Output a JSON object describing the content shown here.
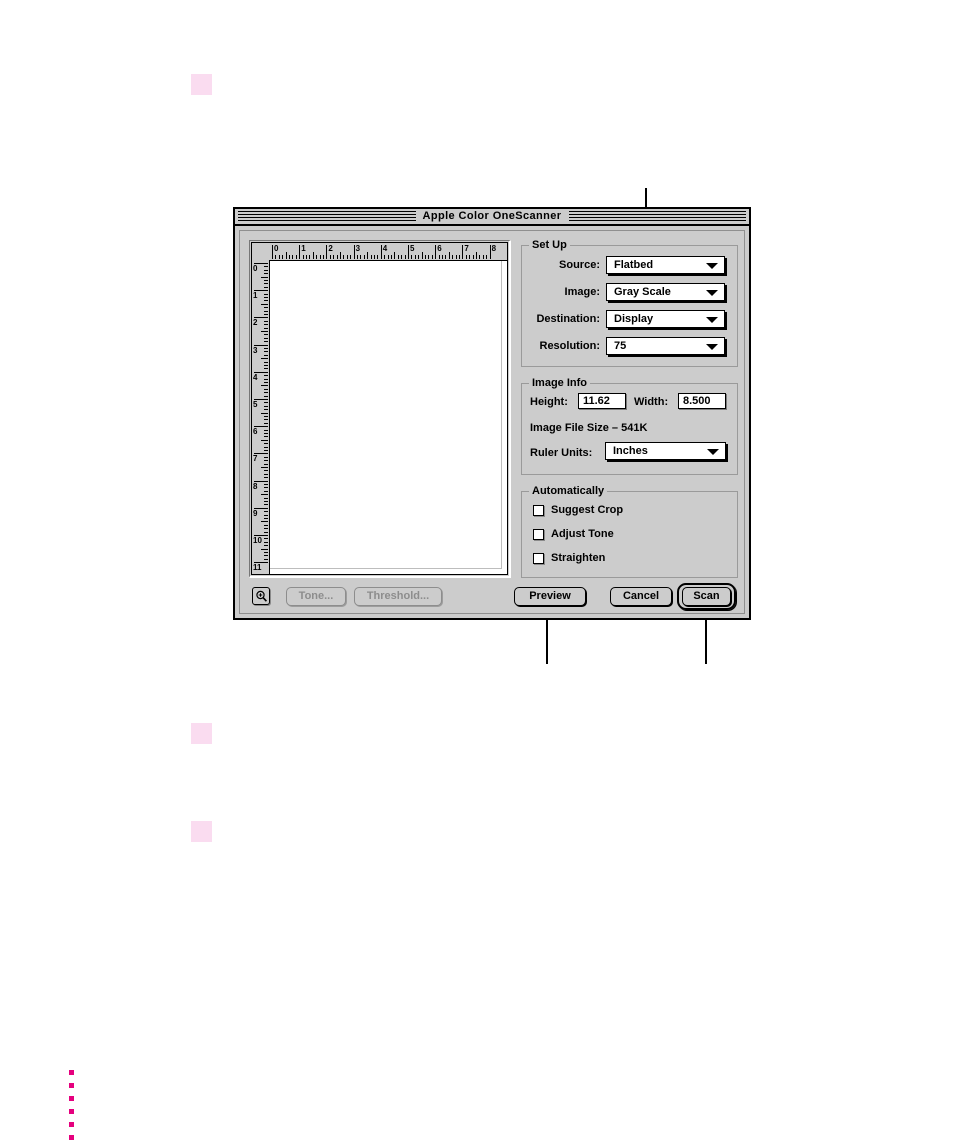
{
  "window": {
    "title": "Apple Color OneScanner"
  },
  "preview": {
    "ruler_horizontal_labels": [
      "0",
      "1",
      "2",
      "3",
      "4",
      "5",
      "6",
      "7",
      "8"
    ],
    "ruler_vertical_labels": [
      "0",
      "1",
      "2",
      "3",
      "4",
      "5",
      "6",
      "7",
      "8",
      "9",
      "10",
      "11"
    ]
  },
  "setup": {
    "legend": "Set Up",
    "rows": [
      {
        "label": "Source:",
        "value": "Flatbed",
        "icon": "chevron-down-icon"
      },
      {
        "label": "Image:",
        "value": "Gray Scale",
        "icon": "chevron-down-icon"
      },
      {
        "label": "Destination:",
        "value": "Display",
        "icon": "chevron-down-icon"
      },
      {
        "label": "Resolution:",
        "value": "75",
        "icon": "chevron-down-icon"
      }
    ]
  },
  "image_info": {
    "legend": "Image Info",
    "height_label": "Height:",
    "height_value": "11.62",
    "width_label": "Width:",
    "width_value": "8.500",
    "file_size_text": "Image File Size – 541K",
    "ruler_units_label": "Ruler Units:",
    "ruler_units_value": "Inches"
  },
  "automatically": {
    "legend": "Automatically",
    "options": [
      {
        "label": "Suggest Crop",
        "checked": false
      },
      {
        "label": "Adjust Tone",
        "checked": false
      },
      {
        "label": "Straighten",
        "checked": false
      }
    ]
  },
  "buttons": {
    "zoom_icon": "magnifier-plus-icon",
    "tone": "Tone...",
    "threshold": "Threshold...",
    "preview": "Preview",
    "cancel": "Cancel",
    "scan": "Scan"
  },
  "colors": {
    "window_face": "#cccccc",
    "callout_line": "#000000",
    "marker_pink": "#fadcf0",
    "marker_magenta": "#e5007e"
  }
}
